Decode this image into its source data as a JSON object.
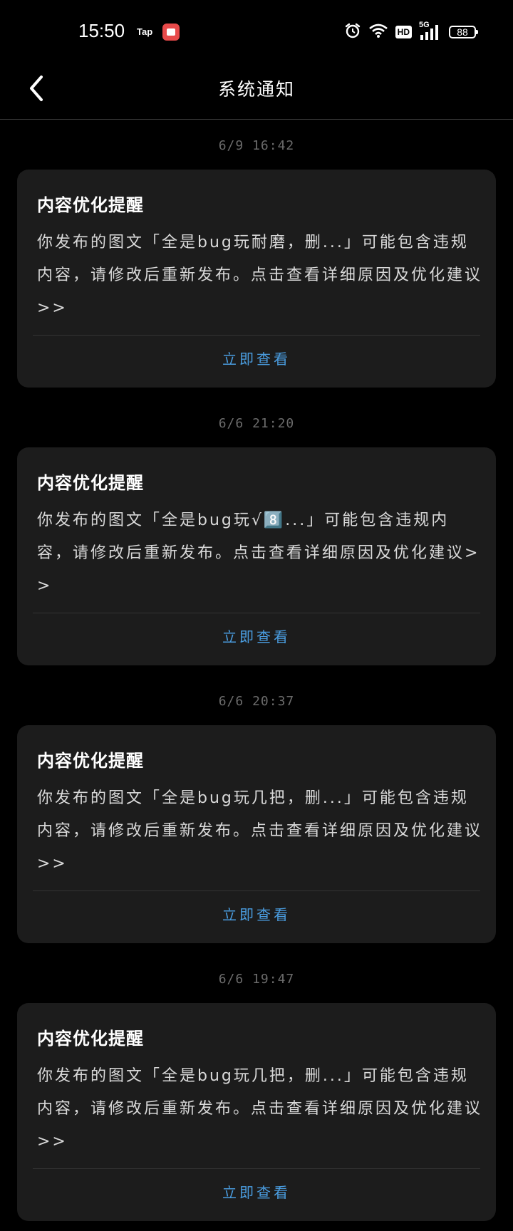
{
  "status_bar": {
    "time": "15:50",
    "tap_label": "Tap",
    "hd_label": "HD",
    "network_label": "5G",
    "battery": "88"
  },
  "header": {
    "title": "系统通知"
  },
  "notices": [
    {
      "time": "6/9  16:42",
      "title": "内容优化提醒",
      "body": "你发布的图文「全是bug玩耐磨，删...」可能包含违规内容，请修改后重新发布。点击查看详细原因及优化建议>>",
      "action": "立即查看"
    },
    {
      "time": "6/6  21:20",
      "title": "内容优化提醒",
      "body": "你发布的图文「全是bug玩√8️⃣...」可能包含违规内容，请修改后重新发布。点击查看详细原因及优化建议>>",
      "action": "立即查看"
    },
    {
      "time": "6/6  20:37",
      "title": "内容优化提醒",
      "body": "你发布的图文「全是bug玩几把，删...」可能包含违规内容，请修改后重新发布。点击查看详细原因及优化建议>>",
      "action": "立即查看"
    },
    {
      "time": "6/6  19:47",
      "title": "内容优化提醒",
      "body": "你发布的图文「全是bug玩几把，删...」可能包含违规内容，请修改后重新发布。点击查看详细原因及优化建议>>",
      "action": "立即查看"
    }
  ],
  "colors": {
    "background": "#000000",
    "card": "#1c1c1c",
    "accent": "#4a9de0",
    "timestamp": "#6b6b6b"
  },
  "icons": {
    "back": "chevron-left-icon",
    "alarm": "alarm-icon",
    "wifi": "wifi-icon",
    "signal": "signal-icon",
    "battery": "battery-icon"
  }
}
